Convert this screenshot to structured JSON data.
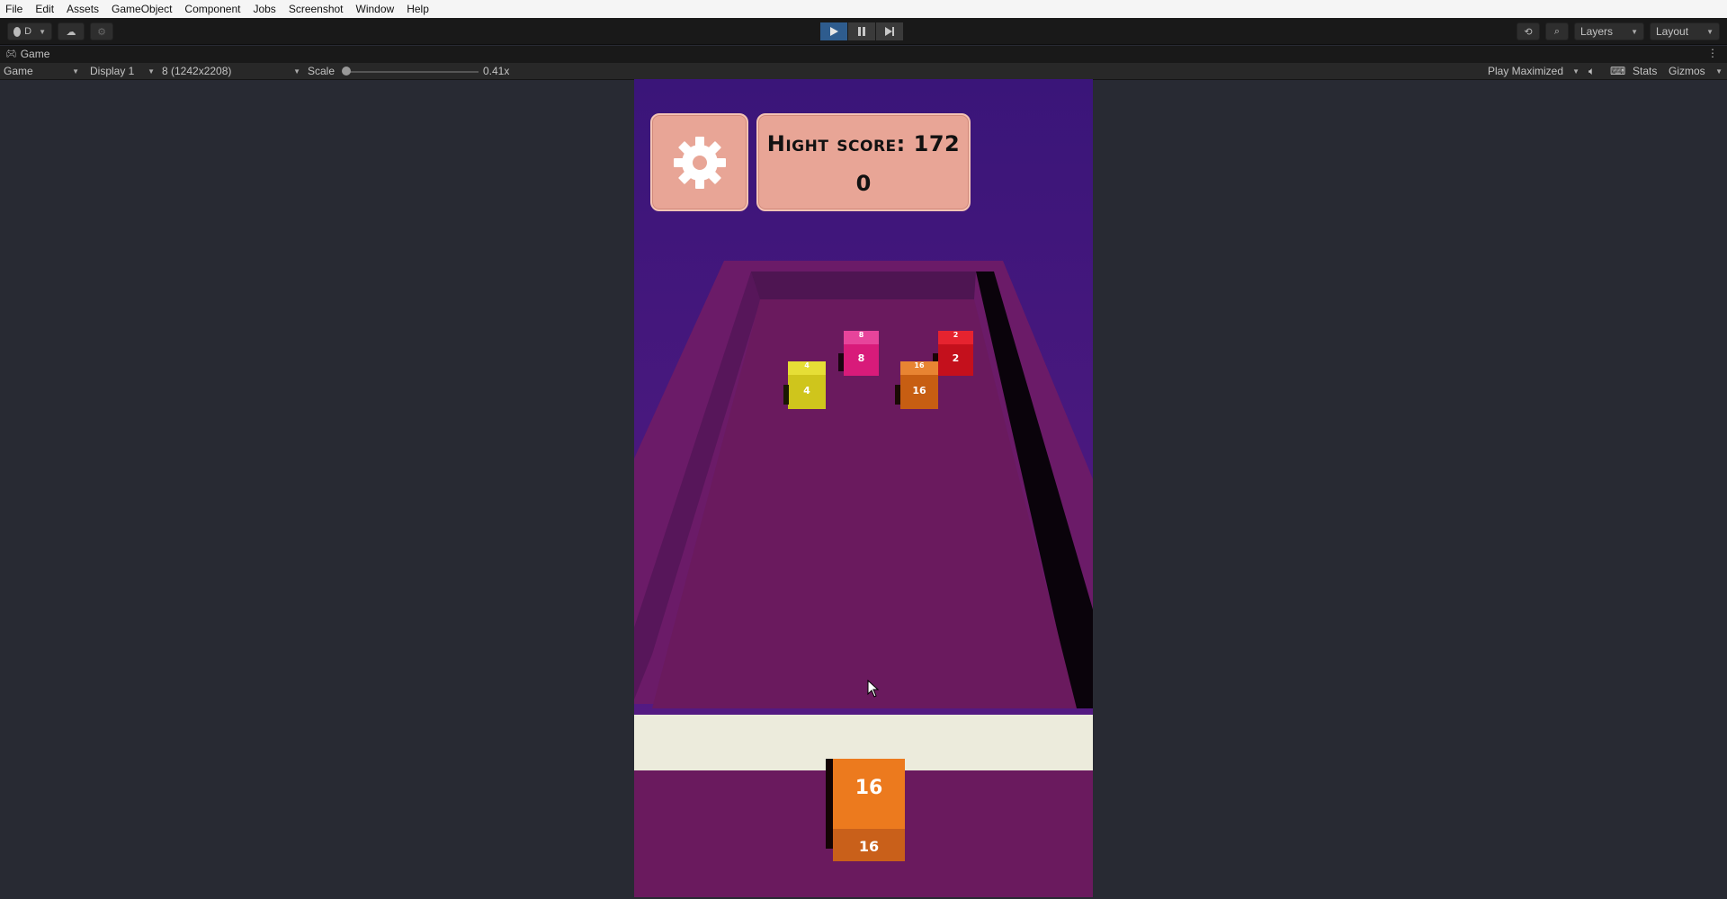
{
  "menu": [
    "File",
    "Edit",
    "Assets",
    "GameObject",
    "Component",
    "Jobs",
    "Screenshot",
    "Window",
    "Help"
  ],
  "toolbar": {
    "account_label": "D",
    "layers_label": "Layers",
    "layout_label": "Layout"
  },
  "tab": {
    "title": "Game"
  },
  "gameview": {
    "mode": "Game",
    "display": "Display 1",
    "resolution": "8 (1242x2208)",
    "scale_label": "Scale",
    "scale_value": "0.41x",
    "play_mode": "Play Maximized",
    "stats": "Stats",
    "gizmos": "Gizmos"
  },
  "game": {
    "high_score_label": "Hight score: 172",
    "score": "0",
    "cubes": [
      {
        "value": "8",
        "color": "#d81b7a"
      },
      {
        "value": "2",
        "color": "#c4101c"
      },
      {
        "value": "4",
        "color": "#cfc51c"
      },
      {
        "value": "16",
        "color": "#d86a16"
      }
    ],
    "player_cube": {
      "value": "16",
      "color": "#ec7a1e"
    }
  },
  "colors": {
    "editor_bg": "#282a33",
    "game_sky": "#3b1678",
    "floor": "#6a1a5e",
    "panel": "#e8a596",
    "play_active": "#2e5c8e"
  }
}
